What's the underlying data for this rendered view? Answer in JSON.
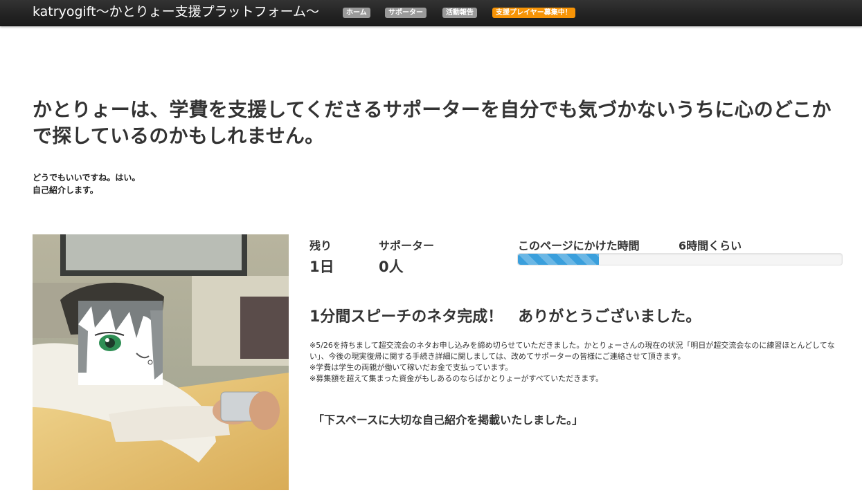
{
  "header": {
    "brand": "katryogift〜かとりょー支援プラットフォーム〜",
    "nav": [
      {
        "label": "ホーム",
        "style": "default"
      },
      {
        "label": "サポーター",
        "style": "default"
      },
      {
        "label": "活動報告",
        "style": "default"
      },
      {
        "label": "支援プレイヤー募集中！",
        "style": "accent"
      }
    ]
  },
  "main": {
    "headline": "かとりょーは、学費を支援してくださるサポーターを自分でも気づかないうちに心のどこかで探しているのかもしれません。",
    "intro": [
      "どうでもいいですね。はい。",
      "自己紹介します。"
    ]
  },
  "stats": {
    "remaining_label": "残り",
    "remaining_value": "1日",
    "supporters_label": "サポーター",
    "supporters_value": "0人",
    "time_label": "このページにかけた時間",
    "time_value": "6時間くらい",
    "progress_fraction": 0.25
  },
  "content": {
    "section_title": "1分間スピーチのネタ完成！　ありがとうございました。",
    "notes": [
      "※5/26を持ちまして超交流会のネタお申し込みを締め切らせていただきました。かとりょーさんの現在の状況「明日が超交流会なのに練習ほとんどしてない」、今後の現実復帰に関する手続き詳細に関しましては、改めてサポーターの皆様にご連絡させて頂きます。",
      "※学費は学生の両親が働いて稼いだお金で支払っています。",
      "※募集額を超えて集まった資金がもしあるのならばかとりょーがすべていただきます。"
    ],
    "callout": "「下スペースに大切な自己紹介を掲載いたしました。」"
  },
  "colors": {
    "accent": "#f89406",
    "nav_default": "#9a9a9a",
    "progress": "#3a9fdc",
    "topbar": "#222222"
  },
  "icons": {
    "profile_photo": "profile-photo-with-anime-face-overlay"
  }
}
